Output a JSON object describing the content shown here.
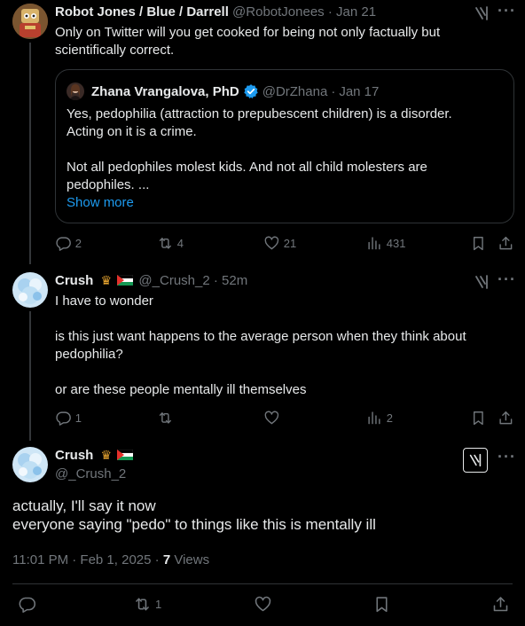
{
  "tweet1": {
    "display_name": "Robot Jones / Blue / Darrell",
    "handle": "@RobotJonees",
    "sep": "·",
    "date": "Jan 21",
    "text_line1": "Only on Twitter will you get cooked for being not only factually but",
    "text_line2": "scientifically correct.",
    "quote": {
      "display_name": "Zhana Vrangalova, PhD",
      "handle": "@DrZhana",
      "sep": "·",
      "date": "Jan 17",
      "line1": "Yes, pedophilia (attraction to prepubescent children) is a disorder.",
      "line2": "Acting on it is a crime.",
      "line3": "Not all pedophiles molest kids. And not all child molesters are",
      "line4": "pedophiles. ...",
      "show_more": "Show more"
    },
    "stats": {
      "replies": "2",
      "reposts": "4",
      "likes": "21",
      "views": "431"
    }
  },
  "tweet2": {
    "display_name": "Crush",
    "handle": "@_Crush_2",
    "sep": "·",
    "time": "52m",
    "line1": "I have to wonder",
    "line2": "is this just want happens to the average person when they think about",
    "line3": "pedophilia?",
    "line4": "or are these people mentally ill themselves",
    "stats": {
      "replies": "1",
      "views": "2"
    }
  },
  "main": {
    "display_name": "Crush",
    "handle": "@_Crush_2",
    "line1": "actually, I'll say it now",
    "line2": "everyone saying \"pedo\" to things like this is mentally ill",
    "timestamp": "11:01 PM · Feb 1, 2025 ·",
    "views_count": "7",
    "views_label": "Views",
    "stats": {
      "reposts": "1"
    }
  },
  "colors": {
    "background": "#000000",
    "text": "#e7e9ea",
    "muted": "#71767b",
    "link": "#1d9bf0",
    "verified": "#1d9bf0",
    "border": "#2f3336"
  },
  "icons": [
    "grok-icon",
    "more-icon",
    "reply-icon",
    "repost-icon",
    "like-icon",
    "views-icon",
    "bookmark-icon",
    "share-icon",
    "verified-badge-icon",
    "crown-emoji",
    "palestine-flag"
  ]
}
